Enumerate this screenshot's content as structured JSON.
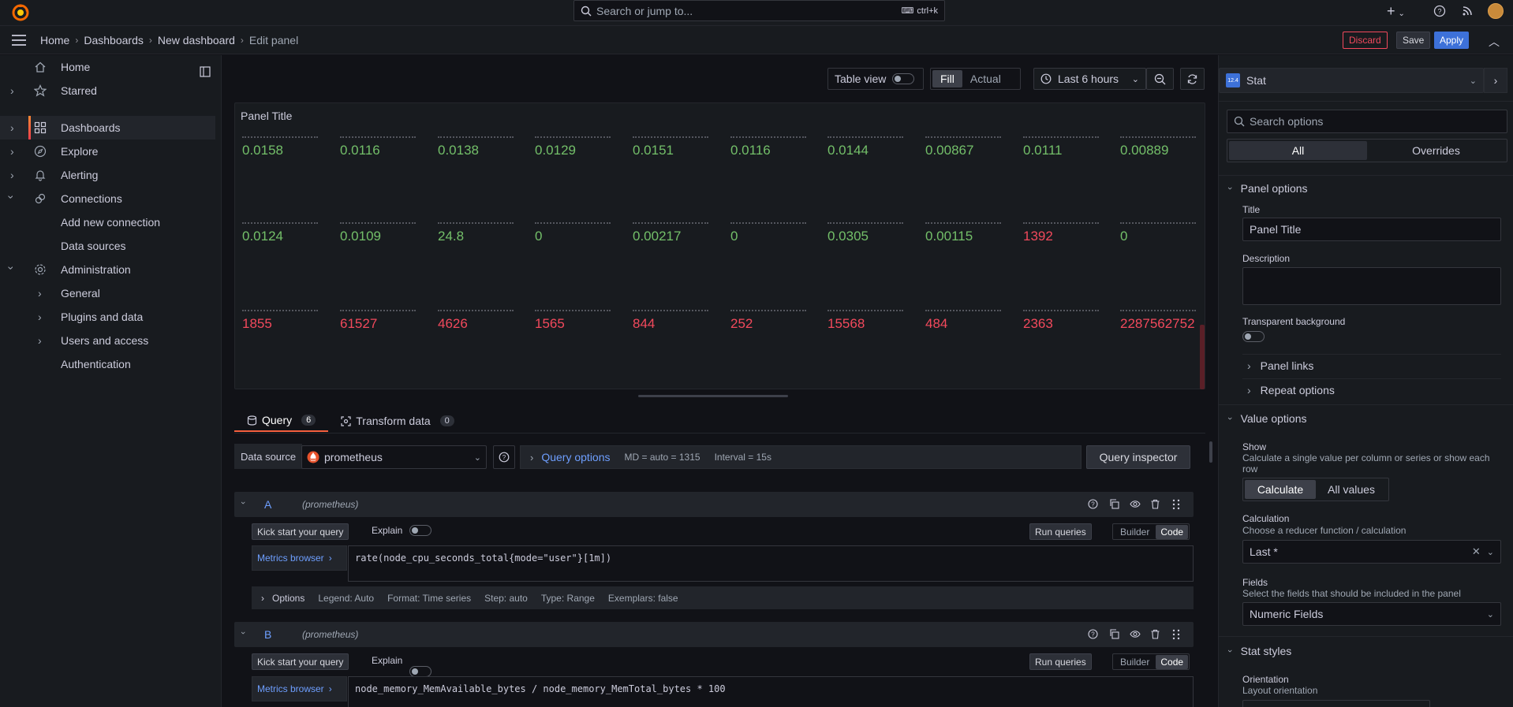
{
  "topbar": {
    "search_placeholder": "Search or jump to...",
    "shortcut": "ctrl+k"
  },
  "breadcrumb": [
    "Home",
    "Dashboards",
    "New dashboard",
    "Edit panel"
  ],
  "actions": {
    "discard": "Discard",
    "save": "Save",
    "apply": "Apply"
  },
  "sidebar": {
    "items": [
      {
        "label": "Home",
        "icon": "home-icon"
      },
      {
        "label": "Starred",
        "icon": "star-icon"
      },
      {
        "label": "Dashboards",
        "icon": "apps-icon"
      },
      {
        "label": "Explore",
        "icon": "compass-icon"
      },
      {
        "label": "Alerting",
        "icon": "bell-icon"
      },
      {
        "label": "Connections",
        "icon": "link-icon"
      },
      {
        "label": "Add new connection"
      },
      {
        "label": "Data sources"
      },
      {
        "label": "Administration",
        "icon": "cog-icon"
      },
      {
        "label": "General"
      },
      {
        "label": "Plugins and data"
      },
      {
        "label": "Users and access"
      },
      {
        "label": "Authentication"
      }
    ]
  },
  "toolbar": {
    "table_view": "Table view",
    "fill": "Fill",
    "actual": "Actual",
    "time_range": "Last 6 hours"
  },
  "panel": {
    "title": "Panel Title",
    "rows": [
      [
        "0.0158",
        "0.0116",
        "0.0138",
        "0.0129",
        "0.0151",
        "0.0116",
        "0.0144",
        "0.00867",
        "0.0111",
        "0.00889"
      ],
      [
        "0.0124",
        "0.0109",
        "24.8",
        "0",
        "0.00217",
        "0",
        "0.0305",
        "0.00115",
        "1392",
        "0"
      ],
      [
        "1855",
        "61527",
        "4626",
        "1565",
        "844",
        "252",
        "15568",
        "484",
        "2363",
        "2287562752"
      ]
    ]
  },
  "colors": {
    "green": "#73bf69",
    "red": "#f2495c",
    "primary": "#3d71d9",
    "accent": "#ff7941"
  },
  "query_tabs": {
    "query": "Query",
    "query_count": "6",
    "transform": "Transform data",
    "transform_count": "0"
  },
  "datasource": {
    "label": "Data source",
    "value": "prometheus",
    "query_options": "Query options",
    "md": "MD = auto = 1315",
    "interval": "Interval = 15s",
    "inspector": "Query inspector"
  },
  "queries": [
    {
      "ref": "A",
      "ds": "(prometheus)",
      "kick": "Kick start your query",
      "explain": "Explain",
      "run": "Run queries",
      "builder": "Builder",
      "code": "Code",
      "metrics": "Metrics browser",
      "expr": "rate(node_cpu_seconds_total{mode=\"user\"}[1m])",
      "options_label": "Options",
      "options": [
        "Legend: Auto",
        "Format: Time series",
        "Step: auto",
        "Type: Range",
        "Exemplars: false"
      ]
    },
    {
      "ref": "B",
      "ds": "(prometheus)",
      "kick": "Kick start your query",
      "explain": "Explain",
      "run": "Run queries",
      "builder": "Builder",
      "code": "Code",
      "metrics": "Metrics browser",
      "expr": "node_memory_MemAvailable_bytes / node_memory_MemTotal_bytes * 100"
    }
  ],
  "viz": {
    "name": "Stat",
    "badge": "12.4"
  },
  "options": {
    "search_placeholder": "Search options",
    "tab_all": "All",
    "tab_overrides": "Overrides",
    "panel_options": "Panel options",
    "title_label": "Title",
    "title_value": "Panel Title",
    "description_label": "Description",
    "transparent_label": "Transparent background",
    "panel_links": "Panel links",
    "repeat_options": "Repeat options",
    "value_options": "Value options",
    "show_label": "Show",
    "show_desc": "Calculate a single value per column or series or show each row",
    "calculate": "Calculate",
    "all_values": "All values",
    "calc_label": "Calculation",
    "calc_desc": "Choose a reducer function / calculation",
    "calc_value": "Last *",
    "fields_label": "Fields",
    "fields_desc": "Select the fields that should be included in the panel",
    "fields_value": "Numeric Fields",
    "stat_styles": "Stat styles",
    "orientation_label": "Orientation",
    "orientation_desc": "Layout orientation"
  }
}
